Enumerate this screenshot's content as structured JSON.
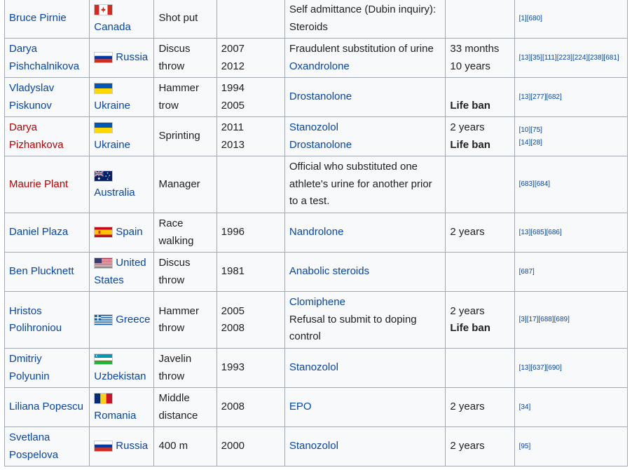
{
  "rows": [
    {
      "name": "Bruce Pirnie",
      "name_link": "blue",
      "country": "Canada",
      "flag_icon": "canada-flag-icon",
      "event": [
        "Shot put"
      ],
      "years": [],
      "substance": [
        {
          "text": "Self admittance (Dubin inquiry):",
          "link": false
        },
        {
          "text": "Steroids",
          "link": false
        }
      ],
      "ban": [],
      "refs": [
        "[1][680]"
      ]
    },
    {
      "name": "Darya Pishchalnikova",
      "name_link": "blue",
      "country": "Russia",
      "flag_icon": "russia-flag-icon",
      "event": [
        "Discus",
        "throw"
      ],
      "years": [
        "2007",
        "2012"
      ],
      "substance": [
        {
          "text": "Fraudulent substitution of urine",
          "link": false
        },
        {
          "text": "Oxandrolone",
          "link": true
        }
      ],
      "ban": [
        {
          "text": "33 months",
          "bold": false
        },
        {
          "text": "10 years",
          "bold": false
        }
      ],
      "refs": [
        "[13][35][111][223][224][238][681]"
      ]
    },
    {
      "name": "Vladyslav Piskunov",
      "name_link": "blue",
      "country": "Ukraine",
      "flag_icon": "ukraine-flag-icon",
      "event": [
        "Hammer",
        "trow"
      ],
      "years": [
        "1994",
        "2005"
      ],
      "substance": [
        {
          "text": "Drostanolone",
          "link": true
        }
      ],
      "ban": [
        {
          "text": "",
          "bold": false
        },
        {
          "text": "Life ban",
          "bold": true
        }
      ],
      "refs": [
        "[13][277][682]"
      ]
    },
    {
      "name": "Darya Pizhankova",
      "name_link": "red",
      "country": "Ukraine",
      "flag_icon": "ukraine-flag-icon",
      "event": [
        "Sprinting"
      ],
      "years": [
        "2011",
        "2013"
      ],
      "substance": [
        {
          "text": "Stanozolol",
          "link": true
        },
        {
          "text": "Drostanolone",
          "link": true
        }
      ],
      "ban": [
        {
          "text": "2 years",
          "bold": false
        },
        {
          "text": "Life ban",
          "bold": true
        }
      ],
      "refs": [
        "[10][75]",
        "[14][28]"
      ]
    },
    {
      "name": "Maurie Plant",
      "name_link": "red",
      "country": "Australia",
      "flag_icon": "australia-flag-icon",
      "event": [
        "Manager"
      ],
      "years": [],
      "substance": [
        {
          "text": "Official who substituted one",
          "link": false
        },
        {
          "text": "athlete's urine for another prior",
          "link": false
        },
        {
          "text": "to a test.",
          "link": false
        }
      ],
      "ban": [],
      "refs": [
        "[683][684]"
      ]
    },
    {
      "name": "Daniel Plaza",
      "name_link": "blue",
      "country": "Spain",
      "flag_icon": "spain-flag-icon",
      "event": [
        "Race",
        "walking"
      ],
      "years": [
        "1996"
      ],
      "substance": [
        {
          "text": "Nandrolone",
          "link": true
        }
      ],
      "ban": [
        {
          "text": "2 years",
          "bold": false
        }
      ],
      "refs": [
        "[13][685][686]"
      ]
    },
    {
      "name": "Ben Plucknett",
      "name_link": "blue",
      "country": "United States",
      "flag_icon": "usa-flag-icon",
      "event": [
        "Discus",
        "throw"
      ],
      "years": [
        "1981"
      ],
      "substance": [
        {
          "text": "Anabolic steroids",
          "link": true
        }
      ],
      "ban": [],
      "refs": [
        "[687]"
      ]
    },
    {
      "name": "Hristos Polihroniou",
      "name_link": "blue",
      "country": "Greece",
      "flag_icon": "greece-flag-icon",
      "event": [
        "Hammer",
        "throw"
      ],
      "years": [
        "2005",
        "2008"
      ],
      "substance": [
        {
          "text": "Clomiphene",
          "link": true
        },
        {
          "text": "Refusal to submit to doping",
          "link": false
        },
        {
          "text": "control",
          "link": false
        }
      ],
      "ban": [
        {
          "text": "2 years",
          "bold": false
        },
        {
          "text": "Life ban",
          "bold": true
        }
      ],
      "refs": [
        "[3][17][688][689]"
      ]
    },
    {
      "name": "Dmitriy Polyunin",
      "name_link": "blue",
      "country": "Uzbekistan",
      "flag_icon": "uzbekistan-flag-icon",
      "event": [
        "Javelin",
        "throw"
      ],
      "years": [
        "1993"
      ],
      "substance": [
        {
          "text": "Stanozolol",
          "link": true
        }
      ],
      "ban": [],
      "refs": [
        "[13][637][690]"
      ]
    },
    {
      "name": "Liliana Popescu",
      "name_link": "blue",
      "country": "Romania",
      "flag_icon": "romania-flag-icon",
      "event": [
        "Middle",
        "distance"
      ],
      "years": [
        "2008"
      ],
      "substance": [
        {
          "text": "EPO",
          "link": true
        }
      ],
      "ban": [
        {
          "text": "2 years",
          "bold": false
        }
      ],
      "refs": [
        "[34]"
      ]
    },
    {
      "name": "Svetlana Pospelova",
      "name_link": "blue",
      "country": "Russia",
      "flag_icon": "russia-flag-icon",
      "event": [
        "400 m"
      ],
      "years": [
        "2000"
      ],
      "substance": [
        {
          "text": "Stanozolol",
          "link": true
        }
      ],
      "ban": [
        {
          "text": "2 years",
          "bold": false
        }
      ],
      "refs": [
        "[95]"
      ]
    }
  ],
  "colors": {
    "link": "#0645ad",
    "redlink": "#ba0000",
    "cell_bg": "#f8f9fa",
    "border": "#a2a9b1"
  }
}
